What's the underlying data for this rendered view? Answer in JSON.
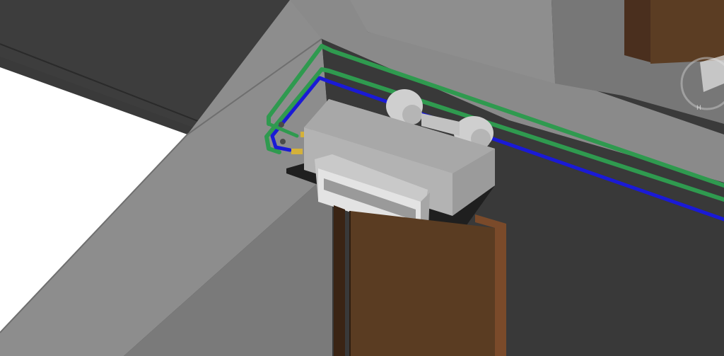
{
  "viewport": {
    "view_type": "3D view",
    "background_color": "#3c3c3c"
  },
  "view_cube": {
    "icon": "view-cube-icon",
    "visible_letters": "H"
  },
  "model": {
    "supply_pipe_color": "#2f9a4f",
    "return_pipe_color": "#1a1ad6",
    "floor_color": "#8b8b8b",
    "wall_color": "#6e6e6e",
    "door_color": "#5a3c22",
    "unit_color": "#a9a9a9",
    "valve_color": "#d4b13a"
  }
}
